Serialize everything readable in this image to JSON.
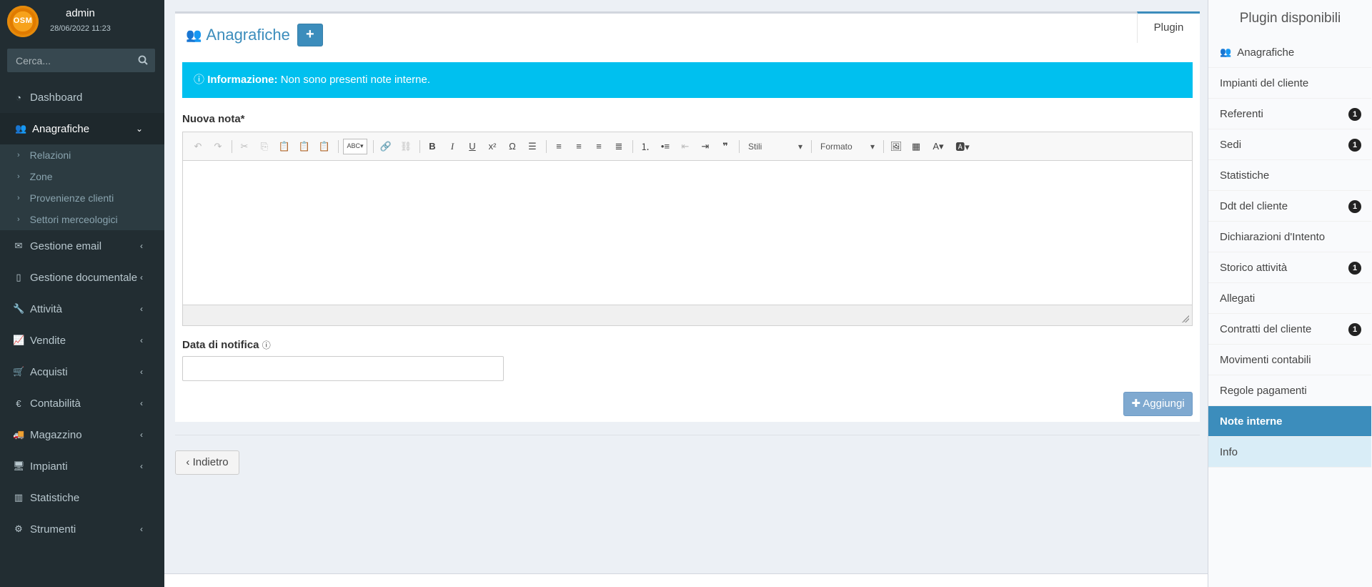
{
  "user": {
    "logo_text": "OSM",
    "name": "admin",
    "datetime": "28/06/2022 11:23"
  },
  "search": {
    "placeholder": "Cerca..."
  },
  "menu": [
    {
      "label": "Dashboard",
      "icon": "dashboard-icon"
    },
    {
      "label": "Anagrafiche",
      "icon": "users-icon",
      "active": true
    },
    {
      "label": "Gestione email",
      "icon": "envelope-icon"
    },
    {
      "label": "Gestione documentale",
      "icon": "file-icon"
    },
    {
      "label": "Attività",
      "icon": "wrench-icon"
    },
    {
      "label": "Vendite",
      "icon": "line-chart-icon"
    },
    {
      "label": "Acquisti",
      "icon": "cart-icon"
    },
    {
      "label": "Contabilità",
      "icon": "euro-icon"
    },
    {
      "label": "Magazzino",
      "icon": "truck-icon"
    },
    {
      "label": "Impianti",
      "icon": "desktop-icon"
    },
    {
      "label": "Statistiche",
      "icon": "bar-chart-icon"
    },
    {
      "label": "Strumenti",
      "icon": "cog-icon"
    }
  ],
  "submenu": [
    {
      "label": "Relazioni"
    },
    {
      "label": "Zone"
    },
    {
      "label": "Provenienze clienti"
    },
    {
      "label": "Settori merceologici"
    }
  ],
  "page": {
    "title": "Anagrafiche",
    "add_label": "+",
    "plugin_tab": "Plugin",
    "info_strong": "Informazione:",
    "info_text": " Non sono presenti note interne.",
    "note_label": "Nuova nota*",
    "date_label": "Data di notifica",
    "add_button": "Aggiungi",
    "back_button": "Indietro"
  },
  "toolbar": {
    "styles": "Stili",
    "format": "Formato"
  },
  "plugins": {
    "title": "Plugin disponibili",
    "items": [
      {
        "label": "Anagrafiche",
        "badge": ""
      },
      {
        "label": "Impianti del cliente",
        "badge": ""
      },
      {
        "label": "Referenti",
        "badge": "1"
      },
      {
        "label": "Sedi",
        "badge": "1"
      },
      {
        "label": "Statistiche",
        "badge": ""
      },
      {
        "label": "Ddt del cliente",
        "badge": "1"
      },
      {
        "label": "Dichiarazioni d'Intento",
        "badge": ""
      },
      {
        "label": "Storico attività",
        "badge": "1"
      },
      {
        "label": "Allegati",
        "badge": ""
      },
      {
        "label": "Contratti del cliente",
        "badge": "1"
      },
      {
        "label": "Movimenti contabili",
        "badge": ""
      },
      {
        "label": "Regole pagamenti",
        "badge": ""
      },
      {
        "label": "Note interne",
        "badge": ""
      },
      {
        "label": "Info",
        "badge": ""
      }
    ]
  },
  "colors": {
    "sidebar": "#222d32",
    "accent": "#3c8dbc",
    "info": "#00c0ef"
  }
}
